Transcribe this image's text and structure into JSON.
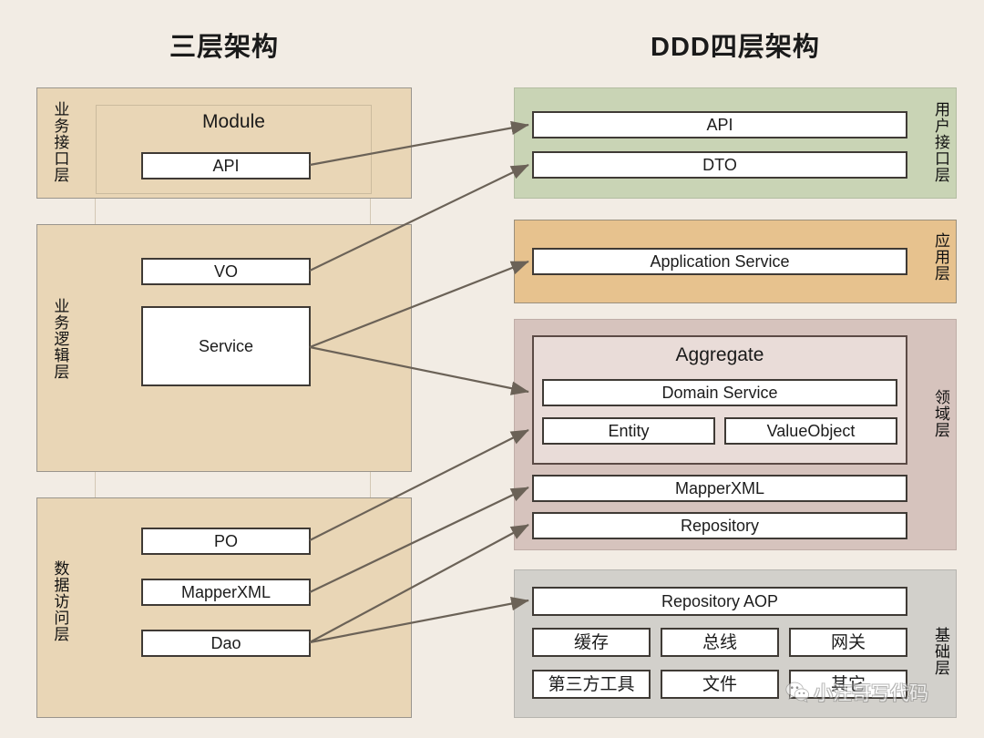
{
  "titles": {
    "left": "三层架构",
    "right": "DDD四层架构"
  },
  "three_tier": {
    "layers": [
      {
        "label": "业务接口层",
        "group_title": "Module",
        "items": [
          "API"
        ]
      },
      {
        "label": "业务逻辑层",
        "items": [
          "VO",
          "Service"
        ]
      },
      {
        "label": "数据访问层",
        "items": [
          "PO",
          "MapperXML",
          "Dao"
        ]
      }
    ]
  },
  "ddd": {
    "layers": [
      {
        "label": "用户接口层",
        "items": [
          "API",
          "DTO"
        ]
      },
      {
        "label": "应用层",
        "items": [
          "Application Service"
        ]
      },
      {
        "label": "领域层",
        "aggregate_title": "Aggregate",
        "aggregate_items": [
          "Domain Service",
          "Entity",
          "ValueObject"
        ],
        "items": [
          "MapperXML",
          "Repository"
        ]
      },
      {
        "label": "基础层",
        "items": [
          "Repository AOP",
          "缓存",
          "总线",
          "网关",
          "第三方工具",
          "文件",
          "其它"
        ]
      }
    ]
  },
  "mappings": [
    {
      "from": "API",
      "to": "API"
    },
    {
      "from": "VO",
      "to": "DTO"
    },
    {
      "from": "Service",
      "to": "Application Service"
    },
    {
      "from": "Service",
      "to": "Domain Service"
    },
    {
      "from": "PO",
      "to": "Entity"
    },
    {
      "from": "MapperXML",
      "to": "MapperXML"
    },
    {
      "from": "Dao",
      "to": "Repository"
    },
    {
      "from": "Dao",
      "to": "Repository AOP"
    }
  ],
  "watermark": {
    "text": "小汪哥写代码",
    "icon": "wechat-icon"
  },
  "colors": {
    "background": "#f2ece4",
    "tier": "#e9d6b6",
    "user_interface_layer": "#c9d4b5",
    "application_layer": "#e7c28e",
    "domain_layer": "#d6c3bd",
    "aggregate": "#e9dcd8",
    "infrastructure_layer": "#d2d0cb",
    "arrow": "#6b6257",
    "cell_border": "#3f3a35"
  }
}
